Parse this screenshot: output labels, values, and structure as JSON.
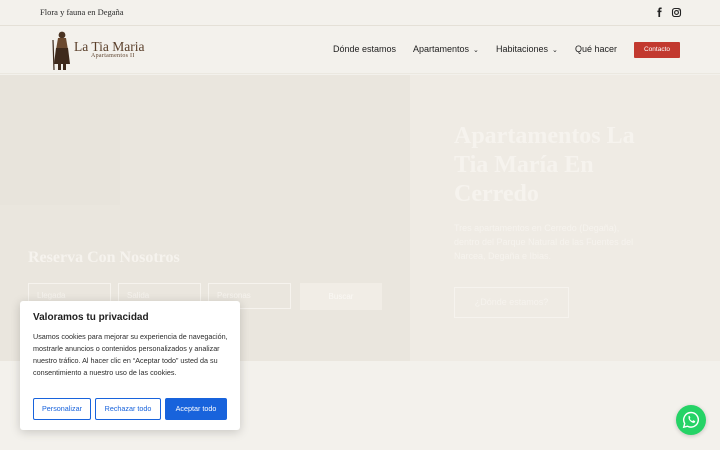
{
  "topbar": {
    "tagline": "Flora y fauna en Degaña",
    "social": [
      {
        "icon": "facebook-icon",
        "glyph": "f"
      },
      {
        "icon": "instagram-icon",
        "glyph": "◎"
      }
    ]
  },
  "header": {
    "logo_title": "La Tia Maria",
    "logo_sub": "Apartamentos II",
    "nav": [
      {
        "label": "Dónde estamos",
        "has_dropdown": false
      },
      {
        "label": "Apartamentos",
        "has_dropdown": true
      },
      {
        "label": "Habitaciones",
        "has_dropdown": true
      },
      {
        "label": "Qué hacer",
        "has_dropdown": false
      }
    ],
    "contact_label": "Contacto"
  },
  "hero": {
    "title": "Apartamentos La Tia María En Cerredo",
    "text": "Tres apartamentos en Cerredo (Degaña), dentro del Parque Natural de las Fuentes del Narcea, Degaña e Ibias.",
    "cta_label": "¿Dónde estamos?",
    "booking_title": "Reserva Con Nosotros",
    "booking_fields": [
      "Llegada",
      "Salida",
      "Personas"
    ],
    "booking_button": "Buscar"
  },
  "cookie": {
    "title": "Valoramos tu privacidad",
    "text": "Usamos cookies para mejorar su experiencia de navegación, mostrarle anuncios o contenidos personalizados y analizar nuestro tráfico. Al hacer clic en “Aceptar todo” usted da su consentimiento a nuestro uso de las cookies.",
    "btn_customize": "Personalizar",
    "btn_reject": "Rechazar todo",
    "btn_accept": "Aceptar todo"
  },
  "colors": {
    "accent": "#c2392f",
    "cookie_blue": "#1863dc",
    "whatsapp": "#25d366",
    "logo_brown": "#5a3f2a"
  }
}
